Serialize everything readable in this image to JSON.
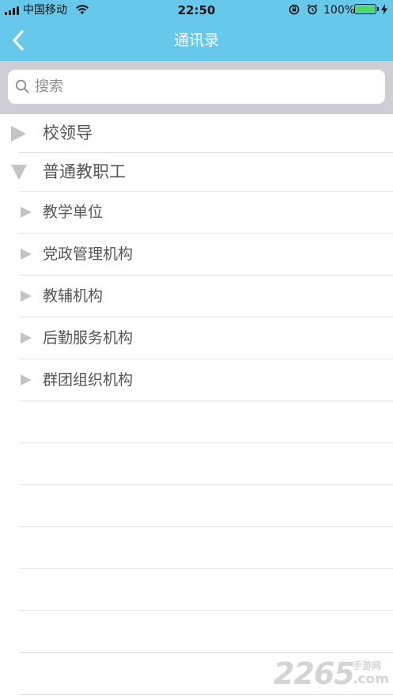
{
  "status_bar": {
    "carrier": "中国移动",
    "time": "22:50",
    "battery_percent": "100%",
    "battery_level": 1.0,
    "icons": [
      "signal-icon",
      "wifi-icon",
      "orientation-lock-icon",
      "alarm-icon",
      "battery-icon",
      "charging-bolt-icon"
    ]
  },
  "nav": {
    "title": "通讯录",
    "back_icon": "chevron-left-icon"
  },
  "search": {
    "placeholder": "搜索",
    "value": "",
    "icon": "search-icon"
  },
  "tree": {
    "groups": [
      {
        "label": "校领导",
        "expanded": false
      },
      {
        "label": "普通教职工",
        "expanded": true,
        "children": [
          {
            "label": "教学单位",
            "expanded": false
          },
          {
            "label": "党政管理机构",
            "expanded": false
          },
          {
            "label": "教辅机构",
            "expanded": false
          },
          {
            "label": "后勤服务机构",
            "expanded": false
          },
          {
            "label": "群团组织机构",
            "expanded": false
          }
        ]
      }
    ]
  },
  "watermark": {
    "number": "2265",
    "site_cn": "手游网",
    "domain": ".com"
  },
  "colors": {
    "header": "#66c9ec",
    "search_band": "#cdcdd3",
    "triangle": "#c4c4c4",
    "label": "#555555",
    "separator": "#e2e2e2"
  }
}
